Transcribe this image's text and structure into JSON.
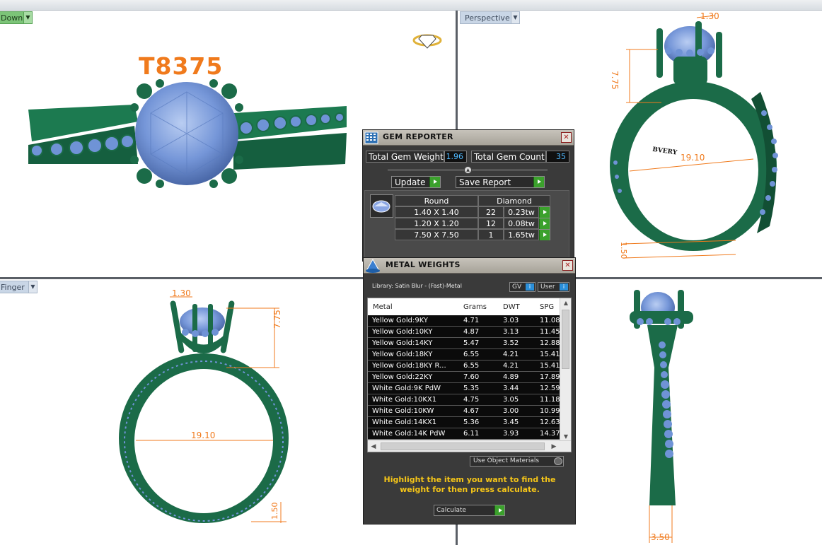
{
  "viewports": {
    "top_left": {
      "label": "Down"
    },
    "top_right": {
      "label": "Perspective"
    },
    "bottom_left": {
      "label": "Finger"
    }
  },
  "model_label": "T8375",
  "dimensions": {
    "prong": "1.30",
    "height": "7.75",
    "diameter": "19.10",
    "shank_thickness": "1.50",
    "shank_width": "3.50"
  },
  "colors": {
    "metal_green": "#1b6b48",
    "gem_blue": "#6f93d6",
    "dimension_orange": "#f07a1c",
    "panel_bg": "#3a3a3a",
    "value_blue": "#4fb9ff",
    "hint_yellow": "#f5c518"
  },
  "gem_reporter": {
    "title": "GEM REPORTER",
    "icon": "gem-reporter-icon",
    "total_weight_label": "Total Gem Weight",
    "total_weight_value": "1.96",
    "total_count_label": "Total Gem Count",
    "total_count_value": "35",
    "update_label": "Update",
    "save_report_label": "Save Report",
    "table_headers": [
      "Round",
      "Diamond"
    ],
    "rows": [
      {
        "size": "1.40 X 1.40",
        "count": "22",
        "weight": "0.23tw"
      },
      {
        "size": "1.20 X 1.20",
        "count": "12",
        "weight": "0.08tw"
      },
      {
        "size": "7.50 X 7.50",
        "count": "1",
        "weight": "1.65tw"
      }
    ]
  },
  "metal_weights": {
    "title": "METAL WEIGHTS",
    "icon": "metal-weights-icon",
    "library_text": "Library: Satin Blur - (Fast)-Metal",
    "gv_label": "GV",
    "user_label": "User",
    "columns": [
      "Metal",
      "Grams",
      "DWT",
      "SPG"
    ],
    "rows": [
      {
        "metal": "Yellow Gold:9KY",
        "grams": "4.71",
        "dwt": "3.03",
        "spg": "11.08"
      },
      {
        "metal": "Yellow Gold:10KY",
        "grams": "4.87",
        "dwt": "3.13",
        "spg": "11.45"
      },
      {
        "metal": "Yellow Gold:14KY",
        "grams": "5.47",
        "dwt": "3.52",
        "spg": "12.88"
      },
      {
        "metal": "Yellow Gold:18KY",
        "grams": "6.55",
        "dwt": "4.21",
        "spg": "15.41"
      },
      {
        "metal": "Yellow Gold:18KY R...",
        "grams": "6.55",
        "dwt": "4.21",
        "spg": "15.41"
      },
      {
        "metal": "Yellow Gold:22KY",
        "grams": "7.60",
        "dwt": "4.89",
        "spg": "17.89"
      },
      {
        "metal": "White Gold:9K PdW",
        "grams": "5.35",
        "dwt": "3.44",
        "spg": "12.59"
      },
      {
        "metal": "White Gold:10KX1",
        "grams": "4.75",
        "dwt": "3.05",
        "spg": "11.18"
      },
      {
        "metal": "White Gold:10KW",
        "grams": "4.67",
        "dwt": "3.00",
        "spg": "10.99"
      },
      {
        "metal": "White Gold:14KX1",
        "grams": "5.36",
        "dwt": "3.45",
        "spg": "12.63"
      },
      {
        "metal": "White Gold:14K PdW",
        "grams": "6.11",
        "dwt": "3.93",
        "spg": "14.37"
      }
    ],
    "use_object_materials_label": "Use Object Materials",
    "hint": "Highlight the item you want to find the weight for then press calculate.",
    "calculate_label": "Calculate"
  }
}
